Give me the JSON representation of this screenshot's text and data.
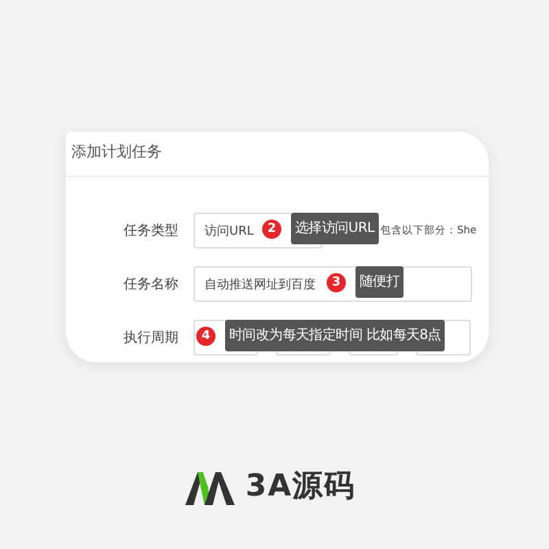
{
  "dialog": {
    "title": "添加计划任务"
  },
  "fields": [
    {
      "label": "任务类型",
      "kind": "select",
      "value": "访问URL",
      "hint": "包含以下部分：She",
      "callout": {
        "number": "2",
        "text": "选择访问URL"
      }
    },
    {
      "label": "任务名称",
      "kind": "text",
      "value": "自动推送网址到百度",
      "callout": {
        "number": "3",
        "text": "随便打"
      }
    },
    {
      "label": "执行周期",
      "kind": "period",
      "callout": {
        "number": "4",
        "text": "时间改为每天指定时间 比如每天8点"
      }
    }
  ],
  "logo": {
    "text": "3A源码"
  }
}
